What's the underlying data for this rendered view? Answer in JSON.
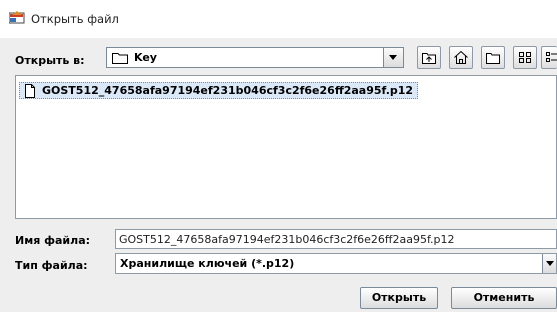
{
  "window": {
    "title": "Открыть файл"
  },
  "look_in": {
    "label": "Открыть в:",
    "value": "Key"
  },
  "toolbar": {
    "icons": [
      "up-folder-icon",
      "home-icon",
      "new-folder-icon",
      "list-view-icon",
      "details-view-icon"
    ]
  },
  "files": [
    {
      "name": "GOST512_47658afa97194ef231b046cf3c2f6e26ff2aa95f.p12",
      "selected": true
    }
  ],
  "file_name": {
    "label": "Имя файла:",
    "value": "GOST512_47658afa97194ef231b046cf3c2f6e26ff2aa95f.p12"
  },
  "file_type": {
    "label": "Тип файла:",
    "value": "Хранилище ключей (*.p12)"
  },
  "buttons": {
    "open": "Открыть",
    "cancel": "Отменить"
  },
  "colors": {
    "selection": "#dbe8f7",
    "border": "#8e9aa6",
    "background": "#eeeeee"
  }
}
